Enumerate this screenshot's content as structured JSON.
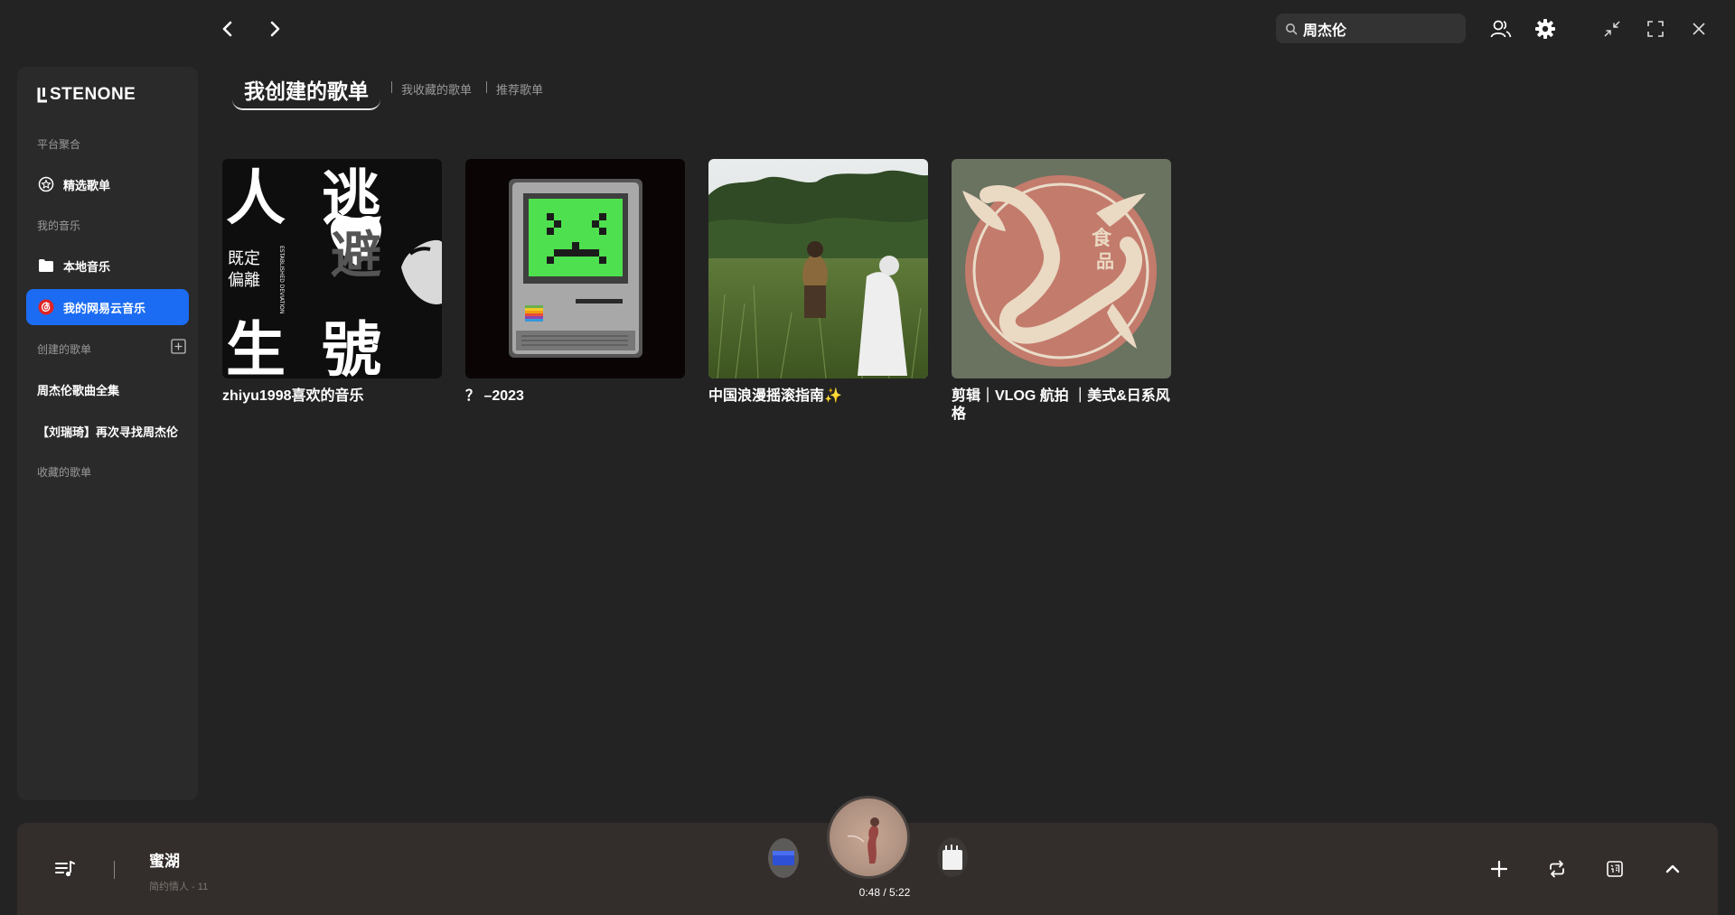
{
  "search": {
    "value": "周杰伦"
  },
  "brand": {
    "logo_text": "STENONE"
  },
  "sidebar": {
    "section_platform": "平台聚合",
    "featured": "精选歌单",
    "section_my_music": "我的音乐",
    "local_music": "本地音乐",
    "netease": "我的网易云音乐",
    "section_created": "创建的歌单",
    "playlists": [
      "周杰伦歌曲全集",
      "【刘瑞琦】再次寻找周杰伦"
    ],
    "section_collected": "收藏的歌单"
  },
  "tabs": {
    "active": "我创建的歌单",
    "collected": "我收藏的歌单",
    "recommended": "推荐歌单"
  },
  "cards": [
    {
      "title": "zhiyu1998喜欢的音乐",
      "cover_text": [
        "人",
        "逃",
        "避",
        "生",
        "號"
      ],
      "cover_small": [
        "既定",
        "偏離"
      ],
      "cover_vertical": "ESTABLISHED DEVIATION"
    },
    {
      "title": "？ –2023"
    },
    {
      "title": "中国浪漫摇滚指南✨"
    },
    {
      "title": "剪辑｜VLOG 航拍 ｜美式&日系风格",
      "cover_text": [
        "食",
        "品"
      ]
    }
  ],
  "player": {
    "title": "蜜湖",
    "subtitle": "简约情人 - 11",
    "time": "0:48 / 5:22"
  },
  "colors": {
    "accent": "#1b6cf2",
    "background": "#232323",
    "sidebar": "#2a2a2a",
    "player": "#332d2b"
  }
}
